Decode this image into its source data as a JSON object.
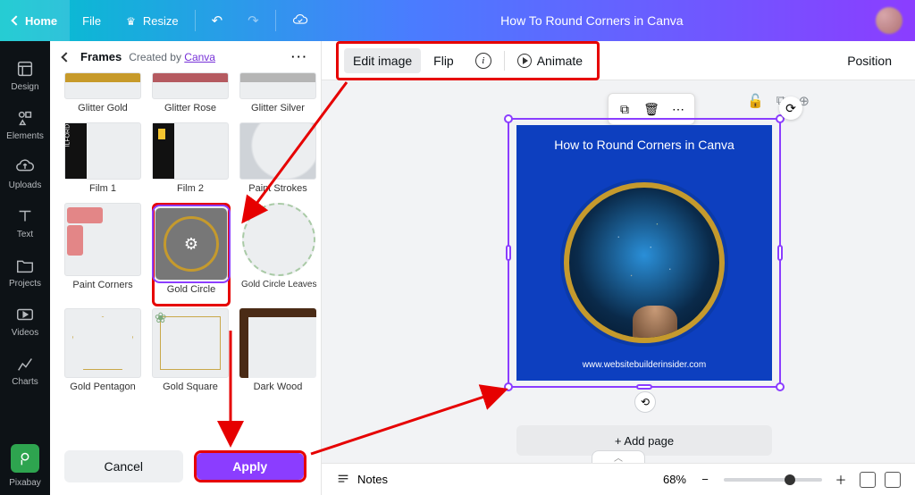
{
  "colors": {
    "accent_purple": "#8b3dff",
    "blue_card": "#0d3fbf",
    "red_annot": "#e60000"
  },
  "topbar": {
    "home": "Home",
    "file": "File",
    "resize": "Resize",
    "doc_title": "How To Round Corners in Canva"
  },
  "rail": [
    {
      "key": "design",
      "label": "Design"
    },
    {
      "key": "elements",
      "label": "Elements"
    },
    {
      "key": "uploads",
      "label": "Uploads"
    },
    {
      "key": "text",
      "label": "Text"
    },
    {
      "key": "projects",
      "label": "Projects"
    },
    {
      "key": "videos",
      "label": "Videos"
    },
    {
      "key": "charts",
      "label": "Charts"
    }
  ],
  "rail_extra": {
    "pixabay": "Pixabay"
  },
  "panel": {
    "title": "Frames",
    "created_by": "Created by ",
    "author": "Canva",
    "grid": [
      [
        {
          "k": "glitter-gold",
          "label": "Glitter Gold"
        },
        {
          "k": "glitter-rose",
          "label": "Glitter Rose"
        },
        {
          "k": "glitter-silver",
          "label": "Glitter Silver"
        }
      ],
      [
        {
          "k": "film1",
          "label": "Film 1"
        },
        {
          "k": "film2",
          "label": "Film 2"
        },
        {
          "k": "paint-strokes",
          "label": "Paint Strokes"
        }
      ],
      [
        {
          "k": "paint-corners",
          "label": "Paint Corners"
        },
        {
          "k": "gold-circle",
          "label": "Gold Circle",
          "selected": true
        },
        {
          "k": "circle-leaves",
          "label": "Gold Circle Leaves"
        }
      ],
      [
        {
          "k": "pentagon",
          "label": "Gold Pentagon"
        },
        {
          "k": "goldsquare",
          "label": "Gold Square"
        },
        {
          "k": "darkwood",
          "label": "Dark Wood"
        }
      ]
    ],
    "cancel": "Cancel",
    "apply": "Apply"
  },
  "ctx": {
    "edit_image": "Edit image",
    "flip": "Flip",
    "animate": "Animate",
    "position": "Position"
  },
  "stage": {
    "page_heading": "How to Round Corners in Canva",
    "url": "www.websitebuilderinsider.com",
    "add_page": "+ Add page"
  },
  "status": {
    "notes": "Notes",
    "zoom": "68%"
  }
}
